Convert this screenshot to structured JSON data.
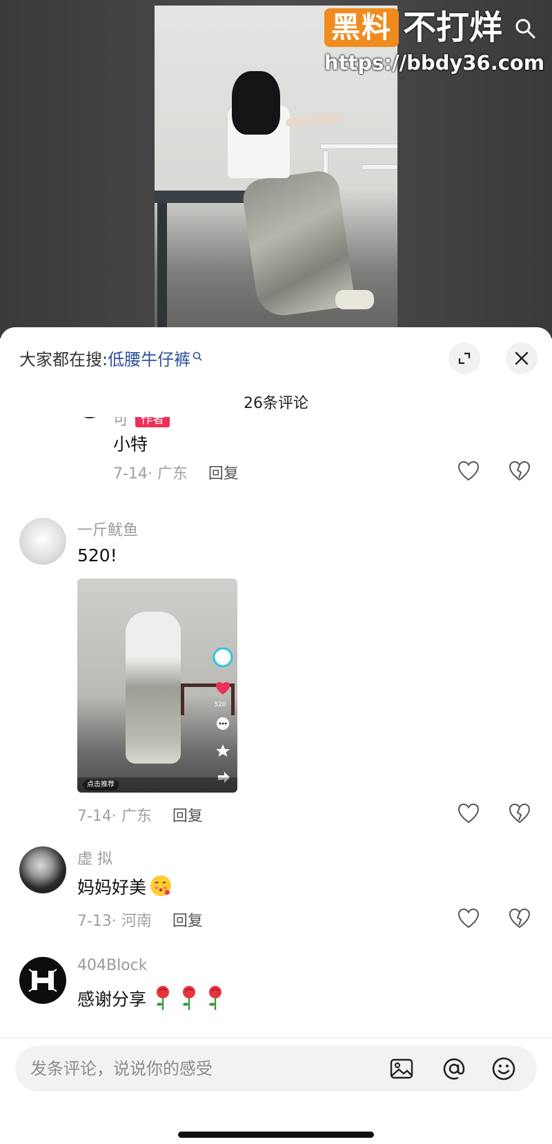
{
  "watermark": {
    "badge": "黑料",
    "title": "不打烊",
    "url": "https://bbdy36.com"
  },
  "header": {
    "search_prefix": "大家都在搜:",
    "search_term": "低腰牛仔裤"
  },
  "comment_count": "26条评论",
  "comments": [
    {
      "user": "可",
      "badge": "作者",
      "text": "小特",
      "date_location": "7-14· 广东",
      "reply": "回复"
    },
    {
      "user": "一斤鱿鱼",
      "text": "520!",
      "image_caption": "点击推荐",
      "image_like_count": "520",
      "date_location": "7-14· 广东",
      "reply": "回复"
    },
    {
      "user": "虚 拟",
      "text": "妈妈好美",
      "emoji": "blush-kiss-emoji",
      "date_location": "7-13· 河南",
      "reply": "回复"
    },
    {
      "user": "404Block",
      "text": "感谢分享",
      "emoji": "rose-emoji"
    }
  ],
  "input": {
    "placeholder": "发条评论，说说你的感受"
  },
  "colors": {
    "author_badge": "#ee2f57",
    "search_term": "#2f4f9c",
    "watermark_badge": "#f08c1f"
  }
}
